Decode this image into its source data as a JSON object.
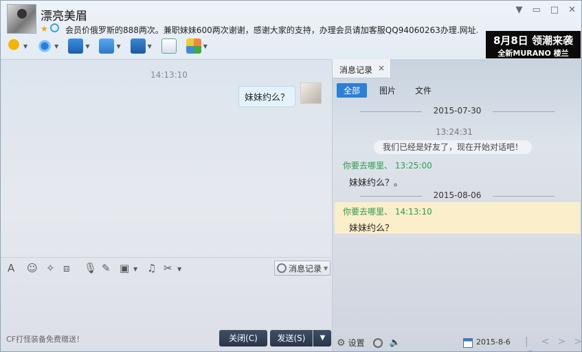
{
  "contact": {
    "name": "漂亮美眉",
    "signature": "会员价俄罗斯的888两次。兼职妹妹600两次谢谢，感谢大家的支持，办理会员请加客服QQ94060263办理.网址..."
  },
  "ad": {
    "line1": "8月8日 领潮来袭",
    "line2": "全新MURANO 楼兰"
  },
  "toolbar": {
    "items": [
      "voice-call",
      "video-call",
      "screen-share",
      "send-file",
      "remote-assist",
      "sms",
      "apps"
    ]
  },
  "chat": {
    "time": "14:13:10",
    "message": "妹妹约么？"
  },
  "input": {
    "history_label": "消息记录",
    "footer_text": "CF打怪装备免费赠送！",
    "close_label": "关闭(C)",
    "send_label": "发送(S)",
    "send_dropdown": "▼"
  },
  "history": {
    "tab_label": "消息记录",
    "tab_close": "×",
    "subtabs": [
      "全部",
      "图片",
      "文件"
    ],
    "date1": "2015-07-30",
    "time1": "13:24:31",
    "sysmsg": "我们已经是好友了，现在开始对话吧！",
    "sender1": "你要去哪里、 13:25:00",
    "msg1": "妹妹约么？。",
    "date2": "2015-08-06",
    "sender2": "你要去哪里、 14:13:10",
    "msg2": "妹妹约么？",
    "settings_label": "设置",
    "current_date": "2015-8-6",
    "nav": [
      "|<",
      "<",
      ">",
      ">|"
    ]
  },
  "window_buttons": [
    "▼",
    "▭",
    "□",
    "✕"
  ]
}
